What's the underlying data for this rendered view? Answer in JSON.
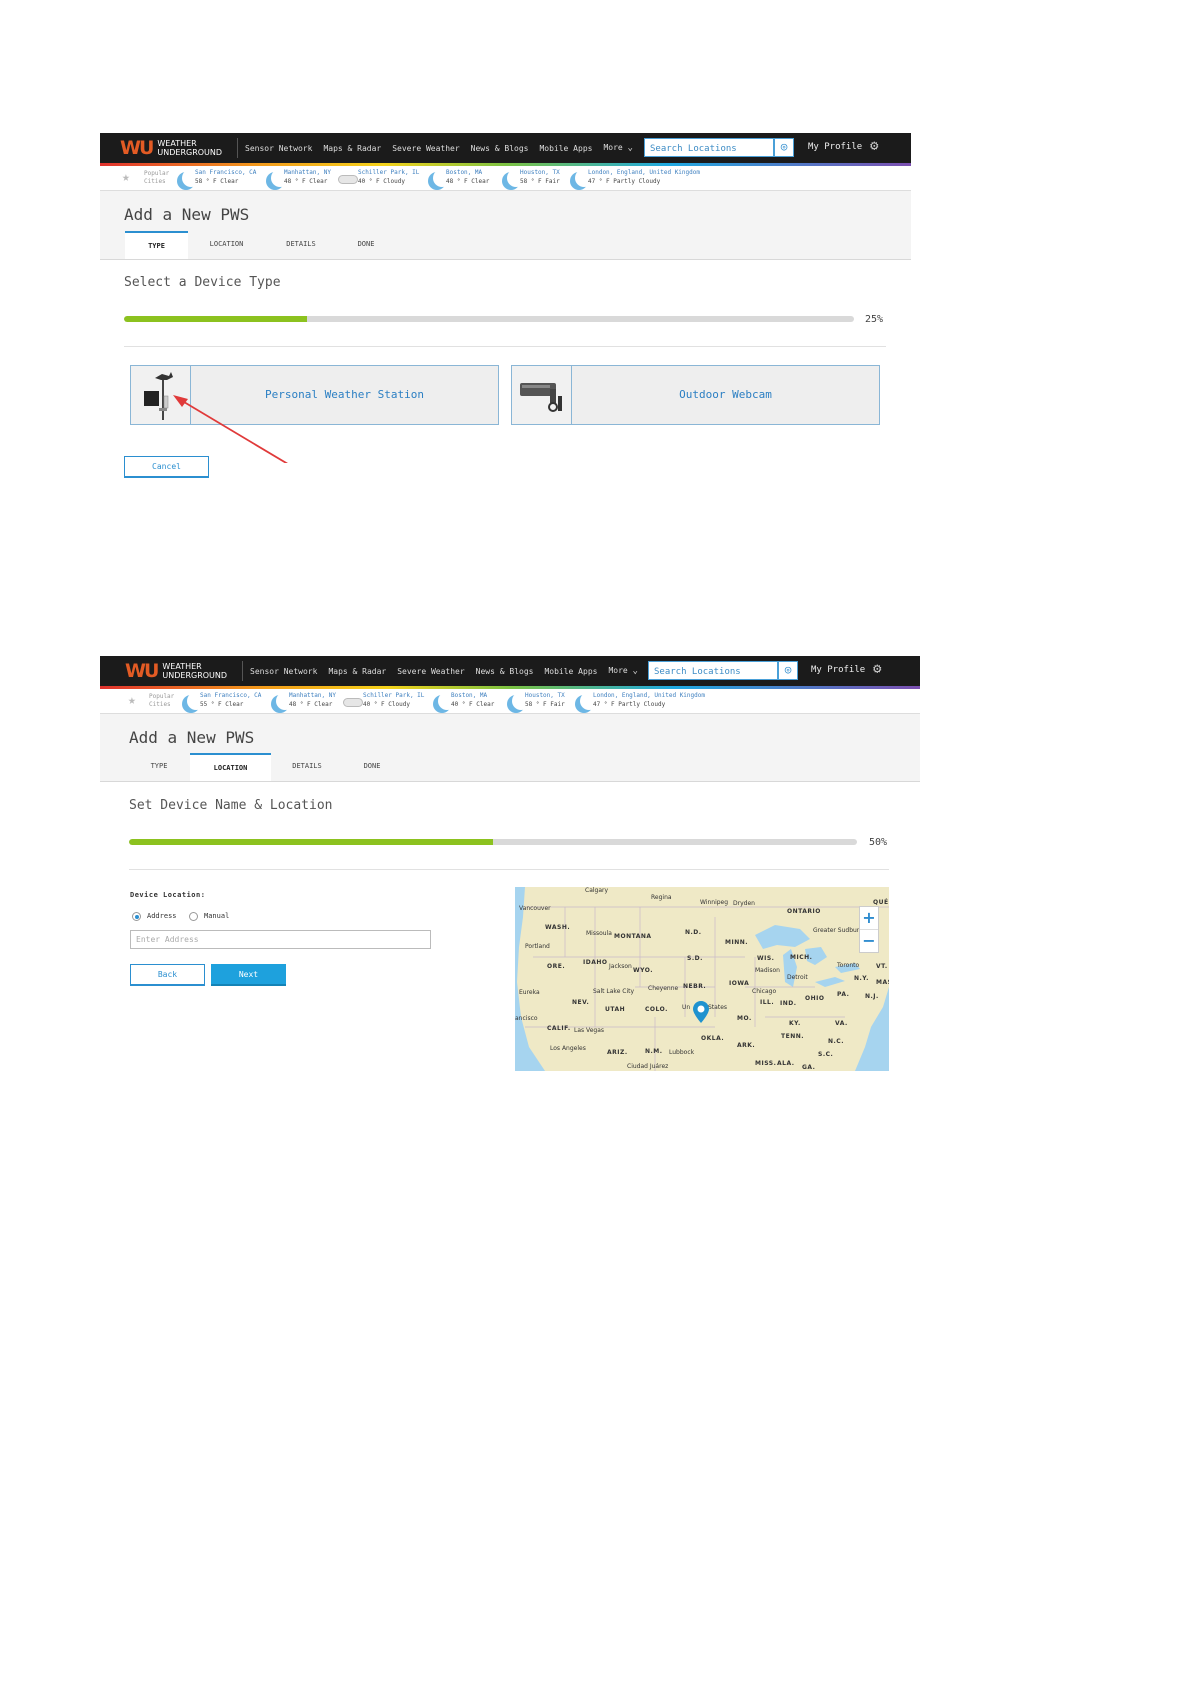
{
  "header": {
    "logo_mark": "WU",
    "logo_line1": "WEATHER",
    "logo_line2": "UNDERGROUND",
    "nav": [
      "Sensor Network",
      "Maps & Radar",
      "Severe Weather",
      "News & Blogs",
      "Mobile Apps",
      "More"
    ],
    "search_placeholder": "Search Locations",
    "profile": "My Profile"
  },
  "cities": {
    "popular_label_1": "Popular",
    "popular_label_2": "Cities",
    "shot1": [
      {
        "name": "San Francisco, CA",
        "temp": "58",
        "cond": "° F Clear",
        "icon": "moon"
      },
      {
        "name": "Manhattan, NY",
        "temp": "48",
        "cond": "° F Clear",
        "icon": "moon"
      },
      {
        "name": "Schiller Park, IL",
        "temp": "40",
        "cond": "° F Cloudy",
        "icon": "cloud"
      },
      {
        "name": "Boston, MA",
        "temp": "48",
        "cond": "° F Clear",
        "icon": "moon"
      },
      {
        "name": "Houston, TX",
        "temp": "58",
        "cond": "° F Fair",
        "icon": "moon-cloud"
      },
      {
        "name": "London, England, United Kingdom",
        "temp": "47",
        "cond": "° F Partly Cloudy",
        "icon": "moon-cloud"
      }
    ],
    "shot2": [
      {
        "name": "San Francisco, CA",
        "temp": "55",
        "cond": "° F Clear",
        "icon": "moon"
      },
      {
        "name": "Manhattan, NY",
        "temp": "48",
        "cond": "° F Clear",
        "icon": "moon"
      },
      {
        "name": "Schiller Park, IL",
        "temp": "40",
        "cond": "° F Cloudy",
        "icon": "cloud"
      },
      {
        "name": "Boston, MA",
        "temp": "40",
        "cond": "° F Clear",
        "icon": "moon"
      },
      {
        "name": "Houston, TX",
        "temp": "58",
        "cond": "° F Fair",
        "icon": "moon-cloud"
      },
      {
        "name": "London, England, United Kingdom",
        "temp": "47",
        "cond": "° F Partly Cloudy",
        "icon": "moon-cloud"
      }
    ]
  },
  "page_title": "Add a New PWS",
  "tabs": [
    "TYPE",
    "LOCATION",
    "DETAILS",
    "DONE"
  ],
  "step1": {
    "subtitle": "Select a Device Type",
    "progress": 25,
    "progress_label": "25%",
    "active_tab": 0,
    "options": [
      "Personal Weather Station",
      "Outdoor Webcam"
    ],
    "cancel": "Cancel",
    "annotation_color": "#e03a3a"
  },
  "step2": {
    "subtitle": "Set Device Name & Location",
    "progress": 50,
    "progress_label": "50%",
    "active_tab": 1,
    "location_label": "Device Location:",
    "radio_address": "Address",
    "radio_manual": "Manual",
    "address_placeholder": "Enter Address",
    "back": "Back",
    "next": "Next",
    "map": {
      "zoom_in": "+",
      "zoom_out": "−",
      "labels": [
        "Calgary",
        "Regina",
        "Winnipeg",
        "Dryden",
        "Vancouver",
        "WASH.",
        "Missoula",
        "MONTANA",
        "N.D.",
        "ONTARIO",
        "QUÉE",
        "Greater Sudbury",
        "Portland",
        "MINN.",
        "ORE.",
        "IDAHO",
        "Jackson",
        "WYO.",
        "S.D.",
        "WIS.",
        "MICH.",
        "Toronto",
        "VT.",
        "Madison",
        "Eureka",
        "Salt Lake City",
        "Cheyenne",
        "NEBR.",
        "IOWA",
        "Chicago",
        "Detroit",
        "N.Y.",
        "MAS",
        "NEV.",
        "UTAH",
        "COLO.",
        "ILL.",
        "IND.",
        "OHIO",
        "PA.",
        "N.J.",
        "States",
        "Un",
        "ancisco",
        "MO.",
        "KY.",
        "VA.",
        "CALIF.",
        "Las Vegas",
        "OKLA.",
        "TENN.",
        "N.C.",
        "Los Angeles",
        "ARIZ.",
        "N.M.",
        "Lubbock",
        "ARK.",
        "S.C.",
        "Ciudad Juárez",
        "MISS.",
        "ALA.",
        "GA."
      ]
    }
  },
  "colors": {
    "accent": "#2b8fd0",
    "progress": "#8cc21f",
    "topbar": "#1b1b1b"
  }
}
